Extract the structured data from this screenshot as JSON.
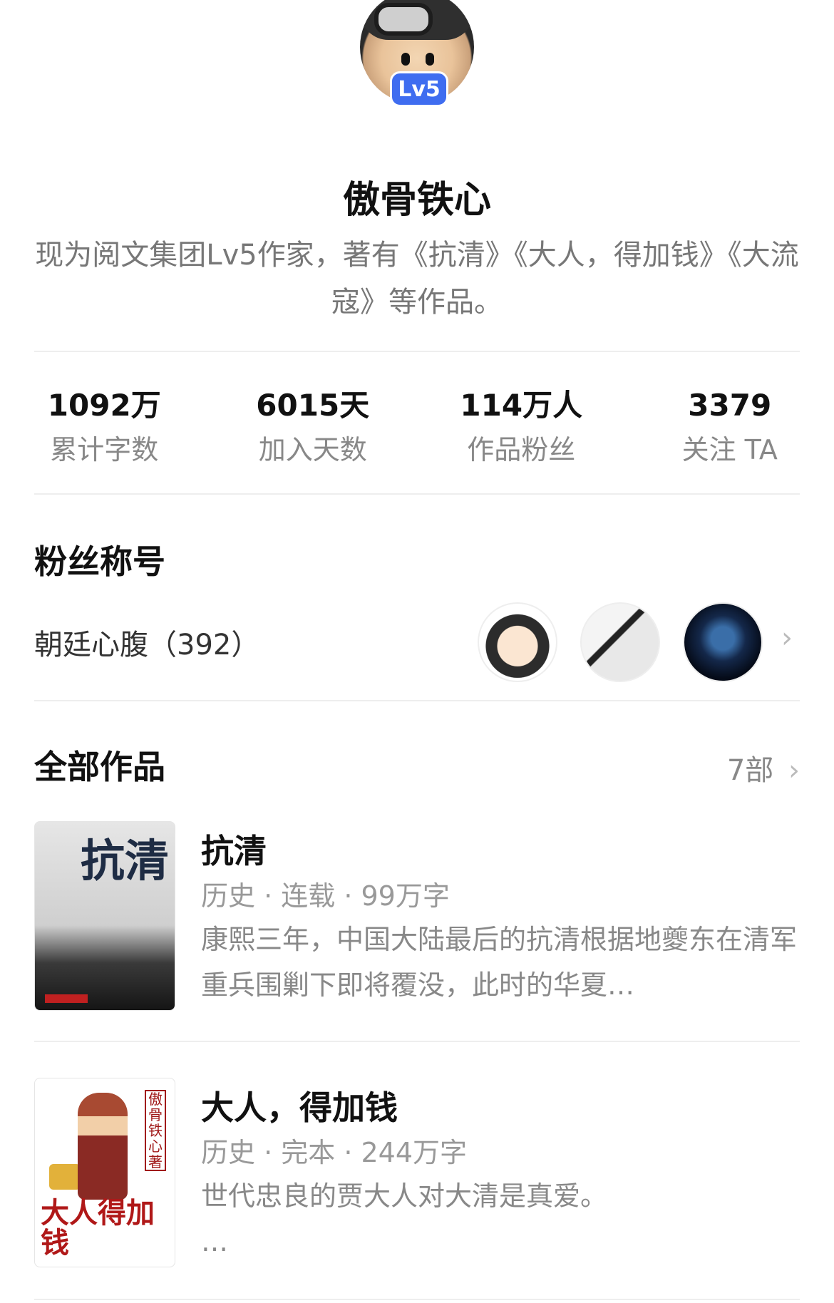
{
  "profile": {
    "level_badge": "Lv5",
    "name": "傲骨铁心",
    "bio": "现为阅文集团Lv5作家，著有《抗清》《大人，得加钱》《大流寇》等作品。"
  },
  "stats": [
    {
      "value": "1092万",
      "label": "累计字数"
    },
    {
      "value": "6015天",
      "label": "加入天数"
    },
    {
      "value": "114万人",
      "label": "作品粉丝"
    },
    {
      "value": "3379",
      "label": "关注 TA"
    }
  ],
  "fan_section": {
    "title": "粉丝称号",
    "fan_title": "朝廷心腹（392）"
  },
  "works_section": {
    "title": "全部作品",
    "count": "7部"
  },
  "books": [
    {
      "cover_text": "抗清",
      "title": "抗清",
      "meta": "历史 · 连载 · 99万字",
      "desc": "康熙三年，中国大陆最后的抗清根据地夔东在清军重兵围剿下即将覆没，此时的华夏…"
    },
    {
      "cover_text": "大人得加钱",
      "cover_vertical": "傲骨铁心著",
      "title": "大人，得加钱",
      "meta": "历史 · 完本 · 244万字",
      "desc": "世代忠良的贾大人对大清是真爱。",
      "desc_more": "…"
    }
  ]
}
